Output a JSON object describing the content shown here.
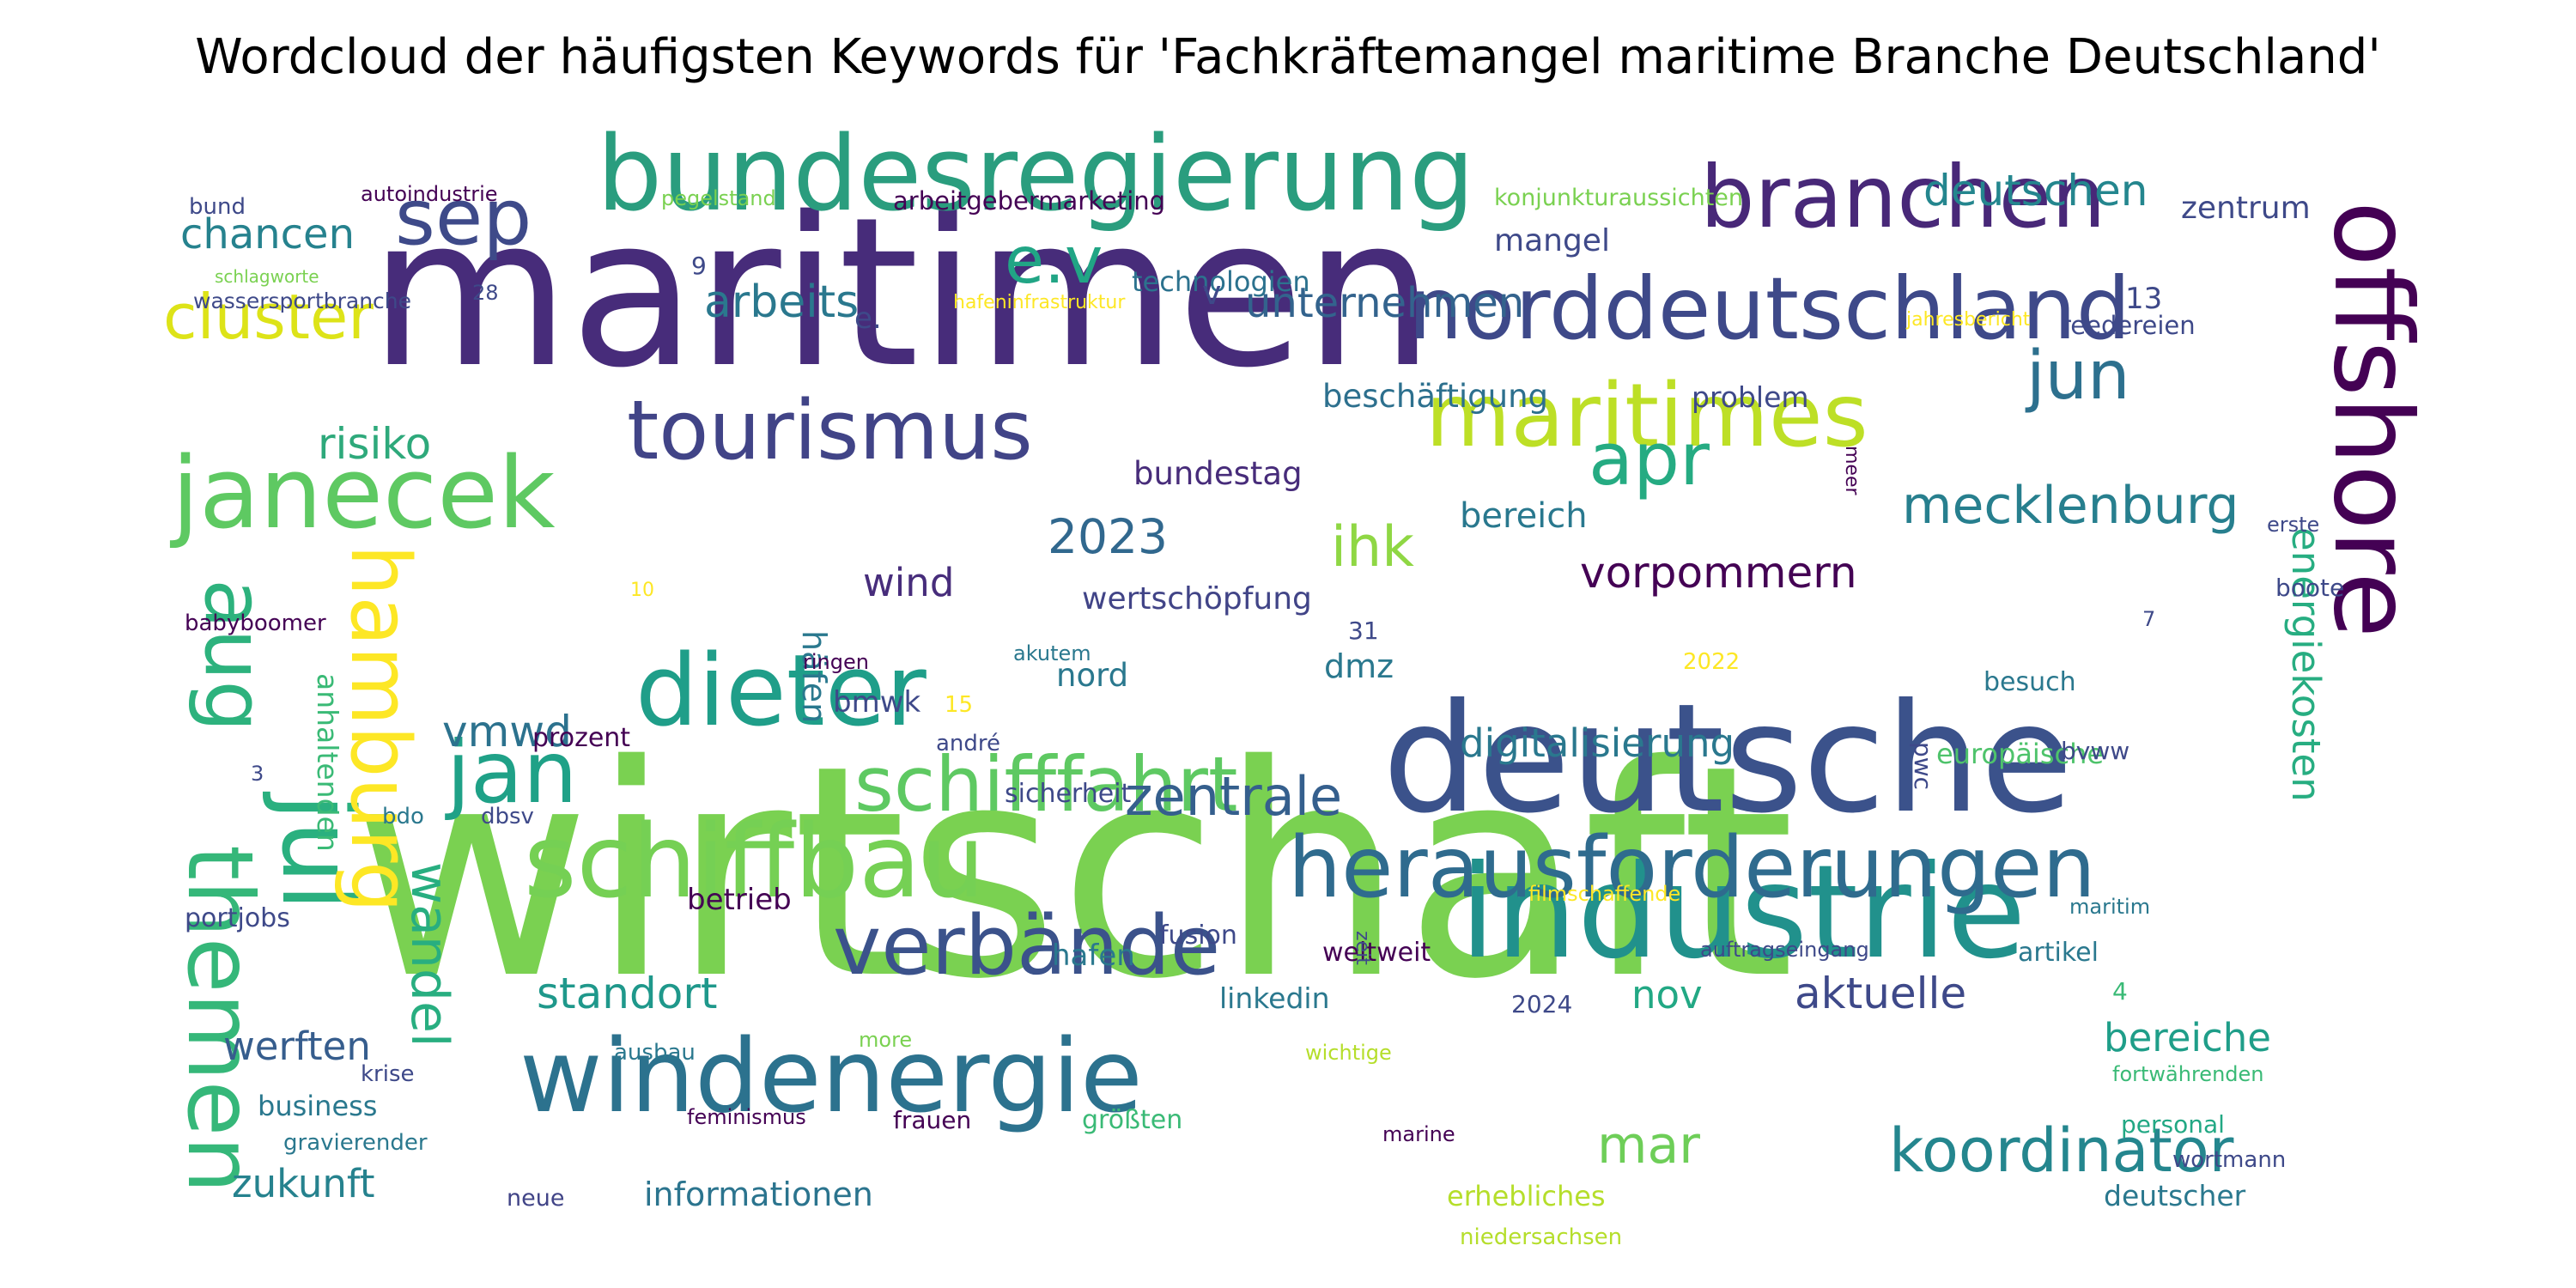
{
  "chart_data": {
    "type": "wordcloud",
    "title": "Wordcloud der häufigsten Keywords für 'Fachkräftemangel maritime Branche Deutschland'",
    "colormap": "viridis",
    "background": "#ffffff",
    "words": [
      {
        "text": "wirtschaft",
        "weight": 1.0,
        "color": "#7ad151"
      },
      {
        "text": "maritimen",
        "weight": 0.86,
        "color": "#472c7a"
      },
      {
        "text": "deutsche",
        "weight": 0.72,
        "color": "#3b528b"
      },
      {
        "text": "industrie",
        "weight": 0.61,
        "color": "#21918c"
      },
      {
        "text": "bundesregierung",
        "weight": 0.55,
        "color": "#2a9d7e"
      },
      {
        "text": "offshore",
        "weight": 0.52,
        "color": "#440154"
      },
      {
        "text": "norddeutschland",
        "weight": 0.49,
        "color": "#3e4989"
      },
      {
        "text": "windenergie",
        "weight": 0.47,
        "color": "#2c728e"
      },
      {
        "text": "herausforderungen",
        "weight": 0.44,
        "color": "#2f6b8e"
      },
      {
        "text": "schiffbau",
        "weight": 0.44,
        "color": "#75d054"
      },
      {
        "text": "branchen",
        "weight": 0.44,
        "color": "#482878"
      },
      {
        "text": "maritimes",
        "weight": 0.43,
        "color": "#bddf26"
      },
      {
        "text": "dieter",
        "weight": 0.42,
        "color": "#1f9e89"
      },
      {
        "text": "janecek",
        "weight": 0.42,
        "color": "#5ec962"
      },
      {
        "text": "verbände",
        "weight": 0.4,
        "color": "#3b528b"
      },
      {
        "text": "tourismus",
        "weight": 0.39,
        "color": "#414487"
      },
      {
        "text": "schifffahrt",
        "weight": 0.38,
        "color": "#5ec962"
      },
      {
        "text": "jul",
        "weight": 0.38,
        "color": "#2ab07f"
      },
      {
        "text": "themen",
        "weight": 0.36,
        "color": "#35b779"
      },
      {
        "text": "hamburg",
        "weight": 0.35,
        "color": "#fde725"
      },
      {
        "text": "aug",
        "weight": 0.35,
        "color": "#2db27d"
      },
      {
        "text": "sep",
        "weight": 0.34,
        "color": "#3e4a89"
      },
      {
        "text": "jan",
        "weight": 0.34,
        "color": "#1fa187"
      },
      {
        "text": "apr",
        "weight": 0.34,
        "color": "#25ab82"
      },
      {
        "text": "cluster",
        "weight": 0.32,
        "color": "#dde318"
      },
      {
        "text": "e.v",
        "weight": 0.32,
        "color": "#21a585"
      },
      {
        "text": "jun",
        "weight": 0.3,
        "color": "#2d708e"
      },
      {
        "text": "wandel",
        "weight": 0.28,
        "color": "#28ae80"
      },
      {
        "text": "koordinator",
        "weight": 0.28,
        "color": "#24868e"
      },
      {
        "text": "mecklenburg",
        "weight": 0.27,
        "color": "#277f8e"
      },
      {
        "text": "zentrale",
        "weight": 0.26,
        "color": "#355f8d"
      },
      {
        "text": "digitalisierung",
        "weight": 0.2,
        "color": "#2a788e"
      },
      {
        "text": "mar",
        "weight": 0.24,
        "color": "#6ece58"
      },
      {
        "text": "energiekosten",
        "weight": 0.22,
        "color": "#27ad81"
      },
      {
        "text": "ihk",
        "weight": 0.25,
        "color": "#8fd744"
      },
      {
        "text": "2023",
        "weight": 0.23,
        "color": "#31688e"
      },
      {
        "text": "risiko",
        "weight": 0.22,
        "color": "#2ea97b"
      },
      {
        "text": "unternehmen",
        "weight": 0.2,
        "color": "#33638d"
      },
      {
        "text": "arbeits",
        "weight": 0.2,
        "color": "#2a788e"
      },
      {
        "text": "chancen",
        "weight": 0.2,
        "color": "#26828e"
      },
      {
        "text": "deutschen",
        "weight": 0.2,
        "color": "#24868e"
      },
      {
        "text": "vmwd",
        "weight": 0.22,
        "color": "#2c728e"
      },
      {
        "text": "vorpommern",
        "weight": 0.2,
        "color": "#440154"
      },
      {
        "text": "aktuelle",
        "weight": 0.21,
        "color": "#3e4989"
      },
      {
        "text": "werften",
        "weight": 0.19,
        "color": "#365d8d"
      },
      {
        "text": "standort",
        "weight": 0.19,
        "color": "#1f988b"
      },
      {
        "text": "nov",
        "weight": 0.18,
        "color": "#22a884"
      },
      {
        "text": "bereiche",
        "weight": 0.18,
        "color": "#1f9e89"
      },
      {
        "text": "zukunft",
        "weight": 0.18,
        "color": "#26828e"
      },
      {
        "text": "wind",
        "weight": 0.18,
        "color": "#472d7b"
      },
      {
        "text": "bereich",
        "weight": 0.17,
        "color": "#29788e"
      },
      {
        "text": "häfen",
        "weight": 0.16,
        "color": "#2a788e"
      },
      {
        "text": "anhaltenden",
        "weight": 0.13,
        "color": "#3aba76"
      },
      {
        "text": "europäische",
        "weight": 0.13,
        "color": "#4ec36b"
      },
      {
        "text": "informationen",
        "weight": 0.13,
        "color": "#2b748e"
      },
      {
        "text": "beschäftigung",
        "weight": 0.13,
        "color": "#2d708e"
      },
      {
        "text": "wertschöpfung",
        "weight": 0.13,
        "color": "#414487"
      },
      {
        "text": "bundestag",
        "weight": 0.13,
        "color": "#472c7a"
      },
      {
        "text": "technologien",
        "weight": 0.11,
        "color": "#2c728e"
      },
      {
        "text": "mangel",
        "weight": 0.12,
        "color": "#3e4989"
      },
      {
        "text": "problem",
        "weight": 0.12,
        "color": "#3e4989"
      },
      {
        "text": "zentrum",
        "weight": 0.12,
        "color": "#3e4989"
      },
      {
        "text": "dmz",
        "weight": 0.13,
        "color": "#2a788e"
      },
      {
        "text": "nord",
        "weight": 0.13,
        "color": "#2a788e"
      },
      {
        "text": "bmwk",
        "weight": 0.12,
        "color": "#3e4989"
      },
      {
        "text": "hafen",
        "weight": 0.12,
        "color": "#2a788e"
      },
      {
        "text": "linkedin",
        "weight": 0.12,
        "color": "#2a788e"
      },
      {
        "text": "betrieb",
        "weight": 0.12,
        "color": "#440154"
      },
      {
        "text": "2024",
        "weight": 0.1,
        "color": "#3e4989"
      },
      {
        "text": "sicherheit",
        "weight": 0.1,
        "color": "#3e4989"
      },
      {
        "text": "fusion",
        "weight": 0.1,
        "color": "#3e4989"
      },
      {
        "text": "weltweit",
        "weight": 0.1,
        "color": "#440154"
      },
      {
        "text": "business",
        "weight": 0.1,
        "color": "#2a788e"
      },
      {
        "text": "größten",
        "weight": 0.1,
        "color": "#3aba76"
      },
      {
        "text": "artikel",
        "weight": 0.1,
        "color": "#2a788e"
      },
      {
        "text": "personal",
        "weight": 0.09,
        "color": "#22a884"
      },
      {
        "text": "wortmann",
        "weight": 0.09,
        "color": "#3e4989"
      },
      {
        "text": "deutscher",
        "weight": 0.1,
        "color": "#2a788e"
      },
      {
        "text": "erhebliches",
        "weight": 0.1,
        "color": "#b5de2b"
      },
      {
        "text": "niedersachsen",
        "weight": 0.08,
        "color": "#b5de2b"
      },
      {
        "text": "frauen",
        "weight": 0.09,
        "color": "#440154"
      },
      {
        "text": "marine",
        "weight": 0.08,
        "color": "#440154"
      },
      {
        "text": "neue",
        "weight": 0.09,
        "color": "#414487"
      },
      {
        "text": "gravierender",
        "weight": 0.08,
        "color": "#2a788e"
      },
      {
        "text": "ausbau",
        "weight": 0.08,
        "color": "#2a788e"
      },
      {
        "text": "krise",
        "weight": 0.08,
        "color": "#3e4989"
      },
      {
        "text": "feminismus",
        "weight": 0.08,
        "color": "#440154"
      },
      {
        "text": "portjobs",
        "weight": 0.09,
        "color": "#3e4989"
      },
      {
        "text": "bdo",
        "weight": 0.08,
        "color": "#2a788e"
      },
      {
        "text": "dbsv",
        "weight": 0.08,
        "color": "#3e4989"
      },
      {
        "text": "babyboomer",
        "weight": 0.08,
        "color": "#440154"
      },
      {
        "text": "bund",
        "weight": 0.08,
        "color": "#3e4989"
      },
      {
        "text": "autoindustrie",
        "weight": 0.07,
        "color": "#440154"
      },
      {
        "text": "pegelstand",
        "weight": 0.07,
        "color": "#7ad151"
      },
      {
        "text": "arbeitgebermarketing",
        "weight": 0.09,
        "color": "#440154"
      },
      {
        "text": "konjunkturaussichten",
        "weight": 0.08,
        "color": "#7ad151"
      },
      {
        "text": "hafeninfrastruktur",
        "weight": 0.07,
        "color": "#fde725"
      },
      {
        "text": "jahresbericht",
        "weight": 0.07,
        "color": "#fde725"
      },
      {
        "text": "reedereien",
        "weight": 0.08,
        "color": "#3e4989"
      },
      {
        "text": "schlagworte",
        "weight": 0.07,
        "color": "#7ad151"
      },
      {
        "text": "wassersportbranche",
        "weight": 0.07,
        "color": "#3e4989"
      },
      {
        "text": "prozent",
        "weight": 0.08,
        "color": "#440154"
      },
      {
        "text": "ringen",
        "weight": 0.07,
        "color": "#440154"
      },
      {
        "text": "akutem",
        "weight": 0.07,
        "color": "#2a788e"
      },
      {
        "text": "2022",
        "weight": 0.07,
        "color": "#fde725"
      },
      {
        "text": "besuch",
        "weight": 0.08,
        "color": "#2a788e"
      },
      {
        "text": "bvww",
        "weight": 0.08,
        "color": "#3e4989"
      },
      {
        "text": "boote",
        "weight": 0.08,
        "color": "#3e4989"
      },
      {
        "text": "erste",
        "weight": 0.07,
        "color": "#3e4989"
      },
      {
        "text": "maritim",
        "weight": 0.07,
        "color": "#2a788e"
      },
      {
        "text": "filmschaffende",
        "weight": 0.07,
        "color": "#fde725"
      },
      {
        "text": "auftragseingang",
        "weight": 0.07,
        "color": "#3e4989"
      },
      {
        "text": "fortwährenden",
        "weight": 0.07,
        "color": "#3aba76"
      },
      {
        "text": "wichtige",
        "weight": 0.07,
        "color": "#b5de2b"
      },
      {
        "text": "more",
        "weight": 0.07,
        "color": "#7ad151"
      },
      {
        "text": "andré",
        "weight": 0.07,
        "color": "#3e4989"
      },
      {
        "text": "pwc",
        "weight": 0.07,
        "color": "#3e4989"
      },
      {
        "text": "zeit",
        "weight": 0.06,
        "color": "#3e4989"
      },
      {
        "text": "meer",
        "weight": 0.06,
        "color": "#440154"
      },
      {
        "text": "e.",
        "weight": 0.08,
        "color": "#3e4989"
      },
      {
        "text": "v",
        "weight": 0.1,
        "color": "#3e4989"
      },
      {
        "text": "13",
        "weight": 0.08,
        "color": "#3e4989"
      },
      {
        "text": "9",
        "weight": 0.07,
        "color": "#3e4989"
      },
      {
        "text": "28",
        "weight": 0.06,
        "color": "#3e4989"
      },
      {
        "text": "31",
        "weight": 0.07,
        "color": "#3e4989"
      },
      {
        "text": "15",
        "weight": 0.07,
        "color": "#fde725"
      },
      {
        "text": "10",
        "weight": 0.06,
        "color": "#fde725"
      },
      {
        "text": "7",
        "weight": 0.06,
        "color": "#3e4989"
      },
      {
        "text": "4",
        "weight": 0.07,
        "color": "#3aba76"
      },
      {
        "text": "3",
        "weight": 0.06,
        "color": "#3e4989"
      }
    ]
  }
}
